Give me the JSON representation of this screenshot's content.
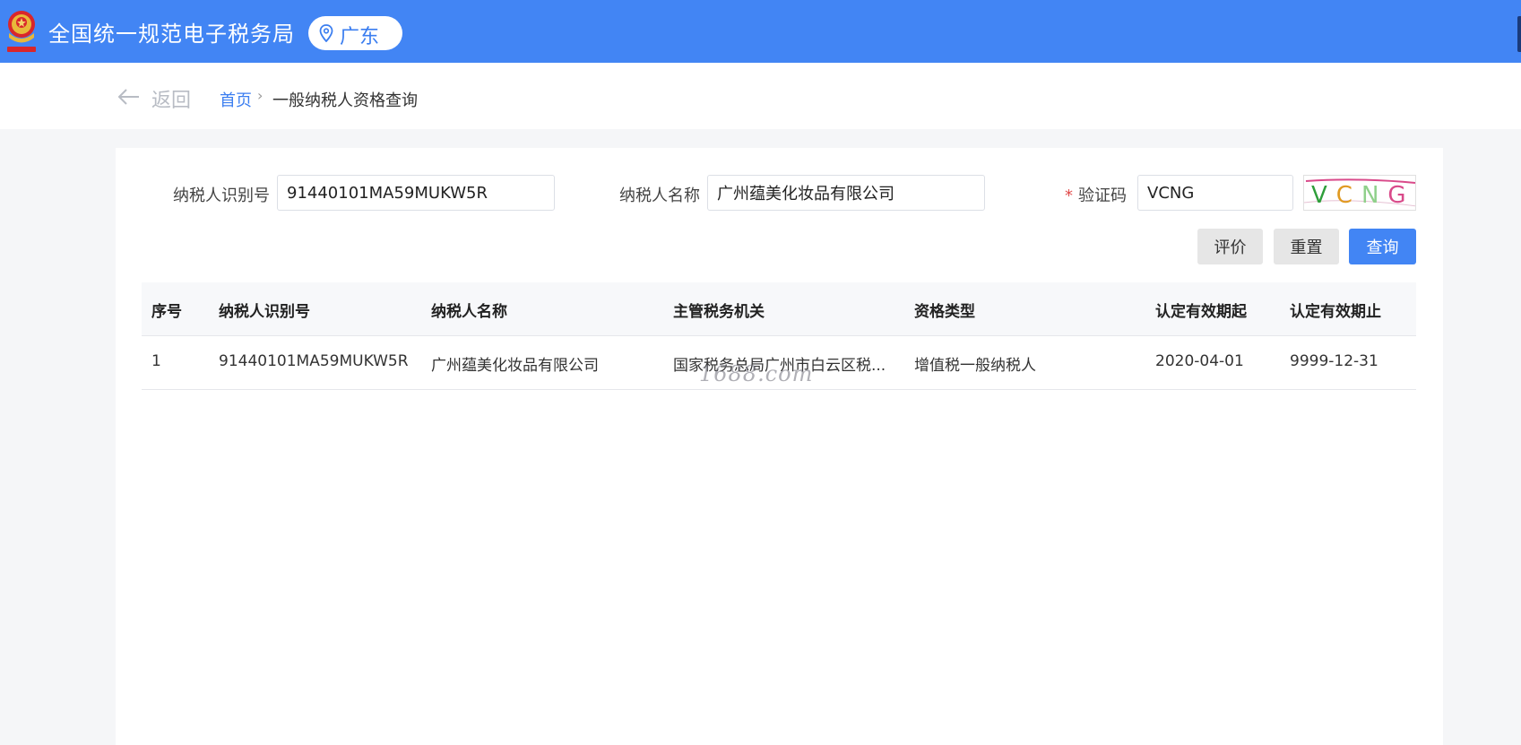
{
  "header": {
    "title": "全国统一规范电子税务局",
    "region": "广东",
    "colors": {
      "bar": "#4285f4",
      "accent": "#3b7ef0"
    }
  },
  "nav": {
    "back_label": "返回",
    "breadcrumb": {
      "home": "首页",
      "separator": "›",
      "current": "一般纳税人资格查询"
    }
  },
  "form": {
    "taxpayer_id": {
      "label": "纳税人识别号",
      "value": "91440101MA59MUKW5R"
    },
    "taxpayer_name": {
      "label": "纳税人名称",
      "value": "广州蕴美化妆品有限公司"
    },
    "captcha": {
      "required_mark": "*",
      "label": "验证码",
      "value": "VCNG",
      "image_text": "VCNG"
    }
  },
  "actions": {
    "evaluate": "评价",
    "reset": "重置",
    "query": "查询"
  },
  "table": {
    "columns": [
      "序号",
      "纳税人识别号",
      "纳税人名称",
      "主管税务机关",
      "资格类型",
      "认定有效期起",
      "认定有效期止"
    ],
    "rows": [
      [
        "1",
        "91440101MA59MUKW5R",
        "广州蕴美化妆品有限公司",
        "国家税务总局广州市白云区税...",
        "增值税一般纳税人",
        "2020-04-01",
        "9999-12-31"
      ]
    ]
  },
  "watermark": "1688.com"
}
